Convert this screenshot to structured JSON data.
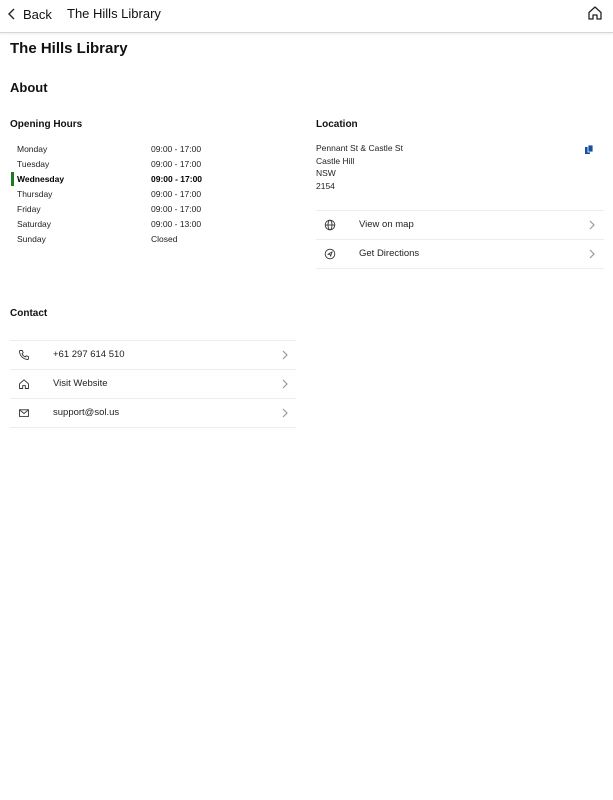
{
  "nav": {
    "back_label": "Back",
    "title": "The Hills Library"
  },
  "page": {
    "title": "The Hills Library",
    "section_about": "About"
  },
  "opening_hours": {
    "heading": "Opening Hours",
    "rows": [
      {
        "day": "Monday",
        "time": "09:00 - 17:00"
      },
      {
        "day": "Tuesday",
        "time": "09:00 - 17:00"
      },
      {
        "day": "Wednesday",
        "time": "09:00 - 17:00"
      },
      {
        "day": "Thursday",
        "time": "09:00 - 17:00"
      },
      {
        "day": "Friday",
        "time": "09:00 - 17:00"
      },
      {
        "day": "Saturday",
        "time": "09:00 - 13:00"
      },
      {
        "day": "Sunday",
        "time": "Closed"
      }
    ],
    "highlighted_day": "Wednesday",
    "highlight_color": "#1f7a1f"
  },
  "location": {
    "heading": "Location",
    "address_lines": [
      "Pennant St & Castle St",
      "Castle Hill",
      "NSW",
      "2154"
    ],
    "copy_icon": "copy-icon",
    "copy_icon_color": "#1a4fa0",
    "actions": [
      {
        "label": "View on map",
        "icon": "globe-icon"
      },
      {
        "label": "Get Directions",
        "icon": "directions-icon"
      }
    ]
  },
  "contact": {
    "heading": "Contact",
    "items": [
      {
        "label": "+61 297 614 510",
        "icon": "phone-icon"
      },
      {
        "label": "Visit Website",
        "icon": "home-icon"
      },
      {
        "label": "support@sol.us",
        "icon": "mail-icon"
      }
    ]
  }
}
